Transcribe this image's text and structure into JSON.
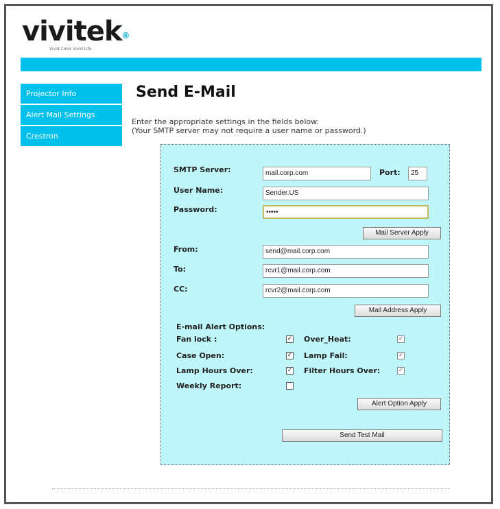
{
  "brand": {
    "name": "vivitek",
    "tagline": "Vivid Color Vivid Life"
  },
  "sidebar": {
    "items": [
      {
        "label": "Projector Info"
      },
      {
        "label": "Alert Mail Settings"
      },
      {
        "label": "Crestron"
      }
    ]
  },
  "page": {
    "title": "Send E-Mail",
    "desc_line1": "Enter the appropriate settings in the fields below:",
    "desc_line2": "(Your SMTP server may not require a user name or password.)"
  },
  "smtp": {
    "server_label": "SMTP Server:",
    "server_value": "mail.corp.com",
    "port_label": "Port:",
    "port_value": "25",
    "user_label": "User Name:",
    "user_value": "Sender.US",
    "password_label": "Password:",
    "password_value": "•••••",
    "apply_label": "Mail Server Apply"
  },
  "address": {
    "from_label": "From:",
    "from_value": "send@mail.corp.com",
    "to_label": "To:",
    "to_value": "rcvr1@mail.corp.com",
    "cc_label": "CC:",
    "cc_value": "rcvr2@mail.corp.com",
    "apply_label": "Mail Address Apply"
  },
  "alerts": {
    "heading": "E-mail Alert Options:",
    "items": [
      {
        "label": "Fan lock :",
        "checked": true
      },
      {
        "label": "Over_Heat:",
        "checked": true
      },
      {
        "label": "Case Open:",
        "checked": true
      },
      {
        "label": "Lamp Fail:",
        "checked": true
      },
      {
        "label": "Lamp Hours Over:",
        "checked": true
      },
      {
        "label": "Filter Hours Over:",
        "checked": true
      },
      {
        "label": "Weekly Report:",
        "checked": false
      }
    ],
    "apply_label": "Alert Option Apply",
    "test_label": "Send Test Mail"
  },
  "check_glyph": "✓"
}
